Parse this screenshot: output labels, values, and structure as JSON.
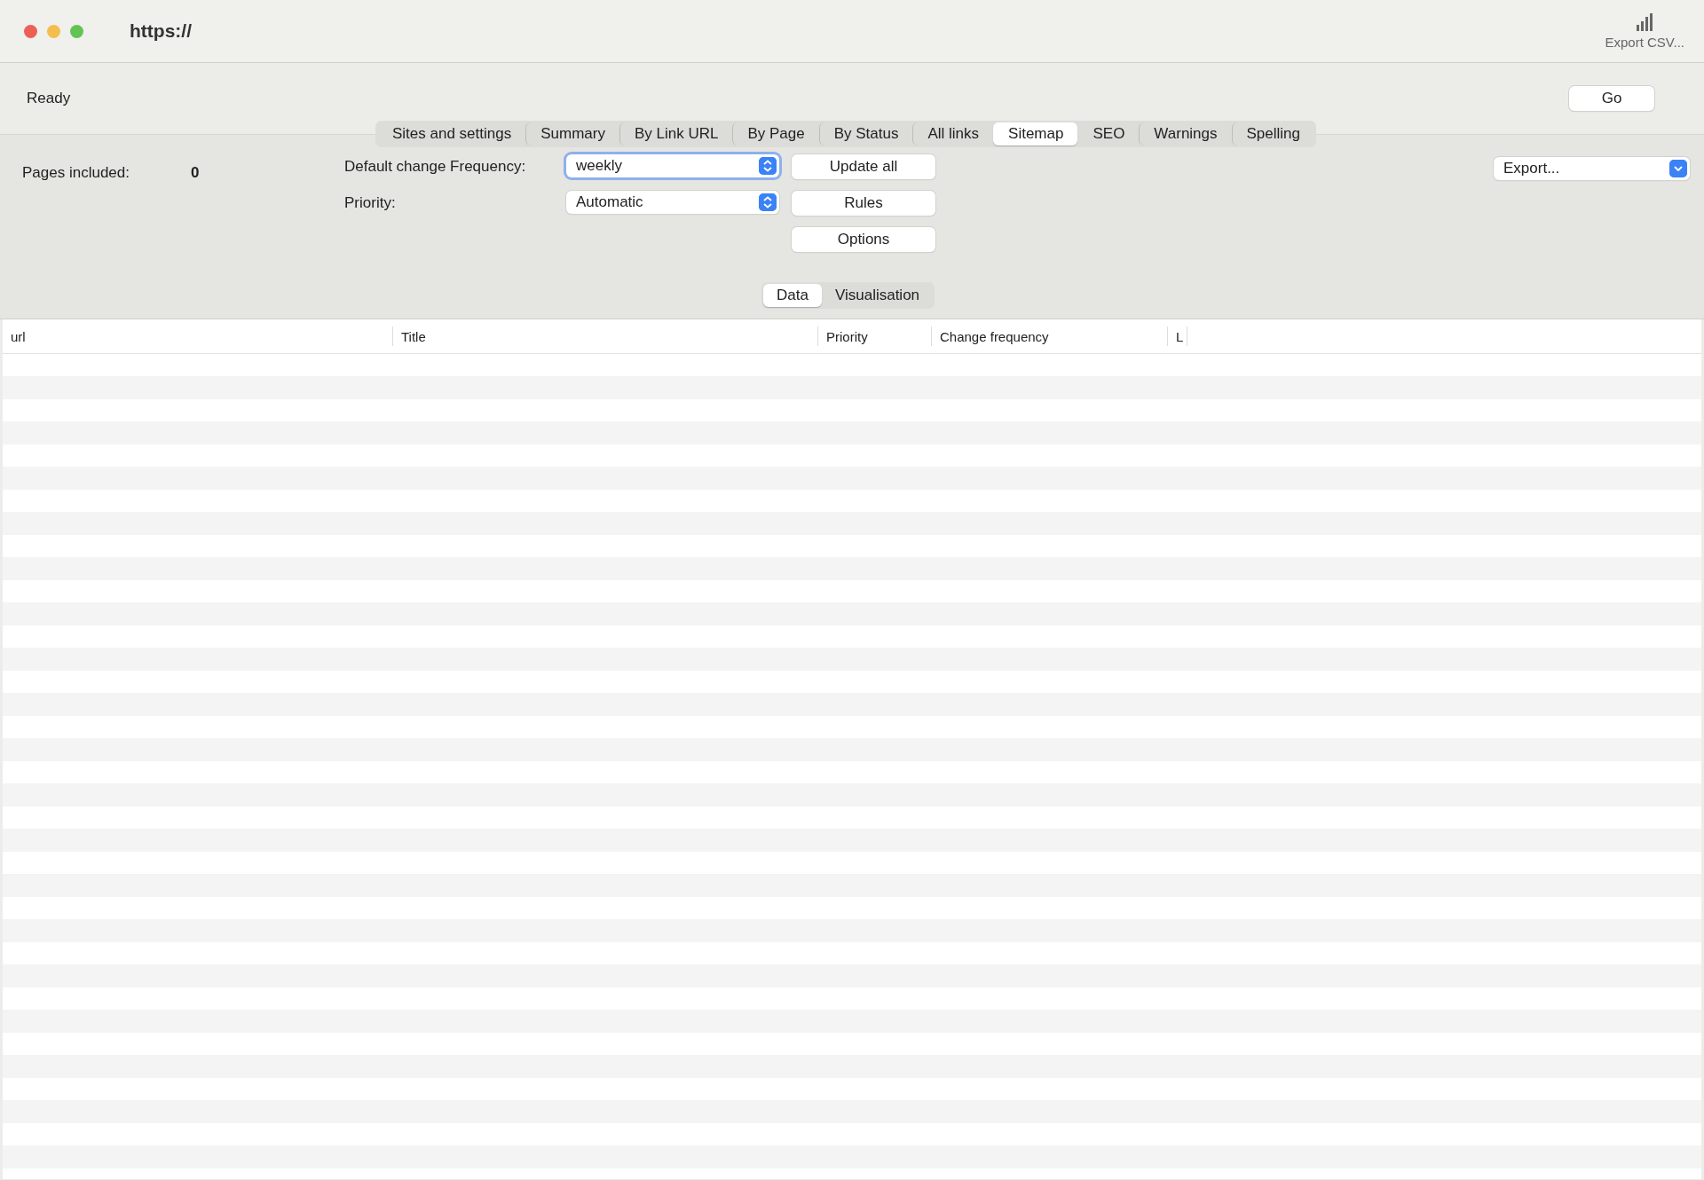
{
  "window": {
    "title": "https://"
  },
  "toolbar": {
    "export_csv": {
      "label": "Export CSV..."
    }
  },
  "status": "Ready",
  "go_button": "Go",
  "tabs": [
    {
      "label": "Sites and settings",
      "selected": false
    },
    {
      "label": "Summary",
      "selected": false
    },
    {
      "label": "By Link URL",
      "selected": false
    },
    {
      "label": "By Page",
      "selected": false
    },
    {
      "label": "By Status",
      "selected": false
    },
    {
      "label": "All links",
      "selected": false
    },
    {
      "label": "Sitemap",
      "selected": true
    },
    {
      "label": "SEO",
      "selected": false
    },
    {
      "label": "Warnings",
      "selected": false
    },
    {
      "label": "Spelling",
      "selected": false
    }
  ],
  "pages_included": {
    "label": "Pages included:",
    "value": "0"
  },
  "settings": [
    {
      "label": "Default change Frequency:",
      "value": "weekly",
      "focused": true
    },
    {
      "label": "Priority:",
      "value": "Automatic",
      "focused": false
    }
  ],
  "buttons": [
    "Update all",
    "Rules",
    "Options"
  ],
  "export": {
    "value": "Export..."
  },
  "view": [
    {
      "label": "Data",
      "selected": true
    },
    {
      "label": "Visualisation",
      "selected": false
    }
  ],
  "table": {
    "columns": [
      "url",
      "Title",
      "Priority",
      "Change frequency",
      "L"
    ]
  }
}
